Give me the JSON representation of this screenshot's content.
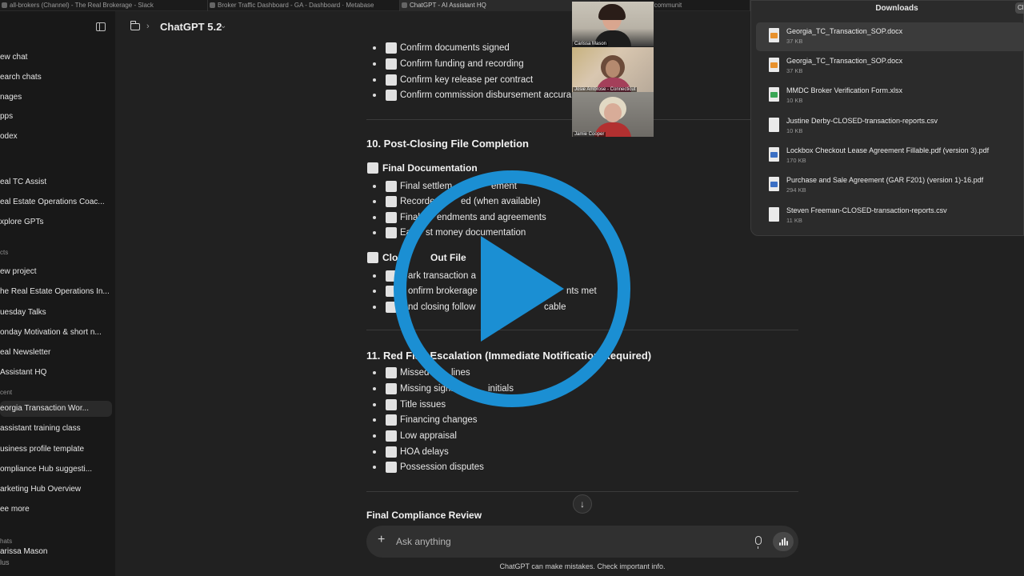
{
  "browser_tabs": [
    {
      "label": "all-brokers (Channel) - The Real Brokerage - Slack",
      "active": false
    },
    {
      "label": "Broker Traffic Dashboard - GA - Dashboard · Metabase",
      "active": false
    },
    {
      "label": "ChatGPT - AI Assistant HQ",
      "active": true
    },
    {
      "label": "Kajabi - /admin/communit",
      "active": false
    }
  ],
  "sidebar": {
    "nav": [
      "ew chat",
      "earch chats",
      "nages",
      "pps",
      "odex"
    ],
    "gpts": [
      "eal TC Assist",
      "eal Estate Operations Coac...",
      "xplore GPTs"
    ],
    "projects_label": "cts",
    "projects": [
      "ew project",
      "he Real Estate Operations In...",
      "uesday Talks",
      "onday Motivation & short n...",
      "eal Newsletter",
      "Assistant HQ"
    ],
    "recent_label": "cent",
    "recent": [
      "eorgia Transaction Wor...",
      "assistant training class",
      "usiness profile template",
      "ompliance Hub suggesti...",
      "arketing Hub Overview",
      "ee more"
    ],
    "chats_label": "hats",
    "user_name": "arissa Mason",
    "user_plan": "lus"
  },
  "header": {
    "model": "ChatGPT 5.2"
  },
  "content": {
    "list_top": [
      "Confirm documents signed",
      "Confirm funding and recording",
      "Confirm key release per contract",
      "Confirm commission disbursement accura"
    ],
    "section10_title": "10. Post-Closing File Completion",
    "final_doc_title": "Final Documentation",
    "final_doc_items": [
      "Final settlem",
      "Recorde",
      "Final",
      "Ea"
    ],
    "final_doc_tails": [
      "ement",
      "ed (when available)",
      "endments and agreements",
      "st money documentation"
    ],
    "closeout_title": "Clos",
    "closeout_tail": "Out File",
    "closeout_items": [
      "ark transaction a",
      "onfirm brokerage",
      "nd closing follow"
    ],
    "closeout_tails": [
      "",
      "nts met",
      "cable"
    ],
    "section11_title": "11. Red Flag Escalation (Immediate Notification Required)",
    "redflag_items": [
      "Missed d",
      "Missing signat",
      "Title issues",
      "Financing changes",
      "Low appraisal",
      "HOA delays",
      "Possession disputes"
    ],
    "redflag_tails": [
      "lines",
      "initials",
      "",
      "",
      "",
      "",
      ""
    ],
    "final_compliance_title": "Final Compliance Review"
  },
  "composer": {
    "placeholder": "Ask anything"
  },
  "disclaimer": "ChatGPT can make mistakes. Check important info.",
  "video_tiles": [
    "Carissa Mason",
    "Josie Ambrose - Connecticut",
    "Jamie Cooper"
  ],
  "downloads": {
    "title": "Downloads",
    "button": "Cl",
    "items": [
      {
        "name": "Georgia_TC_Transaction_SOP.docx",
        "size": "37 KB",
        "kind": "docx"
      },
      {
        "name": "Georgia_TC_Transaction_SOP.docx",
        "size": "37 KB",
        "kind": "docx"
      },
      {
        "name": "MMDC Broker Verification Form.xlsx",
        "size": "10 KB",
        "kind": "xlsx"
      },
      {
        "name": "Justine Derby-CLOSED-transaction-reports.csv",
        "size": "10 KB",
        "kind": "csv"
      },
      {
        "name": "Lockbox Checkout Lease Agreement Fillable.pdf (version 3).pdf",
        "size": "170 KB",
        "kind": "pdf"
      },
      {
        "name": "Purchase and Sale Agreement (GAR F201) (version 1)-16.pdf",
        "size": "294 KB",
        "kind": "pdf"
      },
      {
        "name": "Steven Freeman-CLOSED-transaction-reports.csv",
        "size": "11 KB",
        "kind": "csv"
      }
    ]
  },
  "colors": {
    "accent_play": "#1b8fd3",
    "docx": "#e8912d",
    "xlsx": "#3aa655",
    "pdf": "#3b6fc4",
    "csv": "#cfcfcf"
  },
  "icons": [
    "sidebar-toggle-icon",
    "folder-icon",
    "chevron-right-icon",
    "chevron-down-icon",
    "plus-icon",
    "mic-icon",
    "voice-mode-icon",
    "arrow-down-icon",
    "play-icon",
    "file-icon"
  ]
}
